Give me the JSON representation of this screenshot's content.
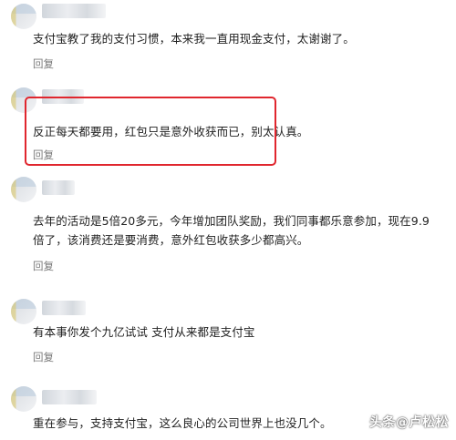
{
  "comments": [
    {
      "text": "支付宝教了我的支付习惯，本来我一直用现金支付，太谢谢了。",
      "reply_label": "回复"
    },
    {
      "text": "反正每天都要用，红包只是意外收获而已，别太认真。",
      "reply_label": "回复"
    },
    {
      "text": "去年的活动是5倍20多元，今年增加团队奖励，我们同事都乐意参加，现在9.9倍了，该消费还是要消费，意外红包收获多少都高兴。",
      "reply_label": "回复"
    },
    {
      "text": "有本事你发个九亿试试 支付从来都是支付宝",
      "reply_label": "回复"
    },
    {
      "text": "重在参与，支持支付宝，这么良心的公司世界上也没几个。",
      "reply_label": ""
    }
  ],
  "watermark": "头条@卢松松"
}
